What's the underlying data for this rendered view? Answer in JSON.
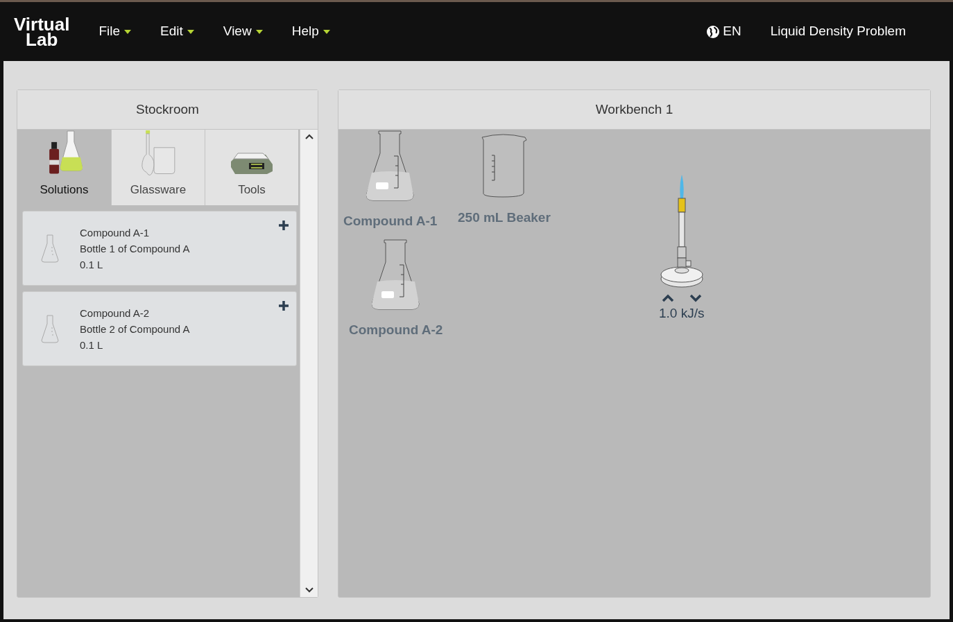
{
  "navbar": {
    "logo_lines": [
      "Virtual",
      "Lab"
    ],
    "menus": [
      "File",
      "Edit",
      "View",
      "Help"
    ],
    "language": "EN",
    "problem_title": "Liquid Density Problem"
  },
  "stockroom": {
    "title": "Stockroom",
    "tabs": [
      {
        "label": "Solutions",
        "kind": "solutions",
        "selected": true
      },
      {
        "label": "Glassware",
        "kind": "glassware",
        "selected": false
      },
      {
        "label": "Tools",
        "kind": "tools",
        "selected": false
      }
    ],
    "items": [
      {
        "name": "Compound A-1",
        "description": "Bottle 1 of Compound A",
        "volume": "0.1 L"
      },
      {
        "name": "Compound A-2",
        "description": "Bottle 2 of Compound A",
        "volume": "0.1 L"
      }
    ]
  },
  "workbench": {
    "title": "Workbench 1",
    "objects": [
      {
        "kind": "flask",
        "label": "Compound A-1"
      },
      {
        "kind": "beaker",
        "label": "250 mL Beaker"
      },
      {
        "kind": "flask",
        "label": "Compound A-2"
      },
      {
        "kind": "burner",
        "label": "1.0 kJ/s"
      }
    ]
  }
}
